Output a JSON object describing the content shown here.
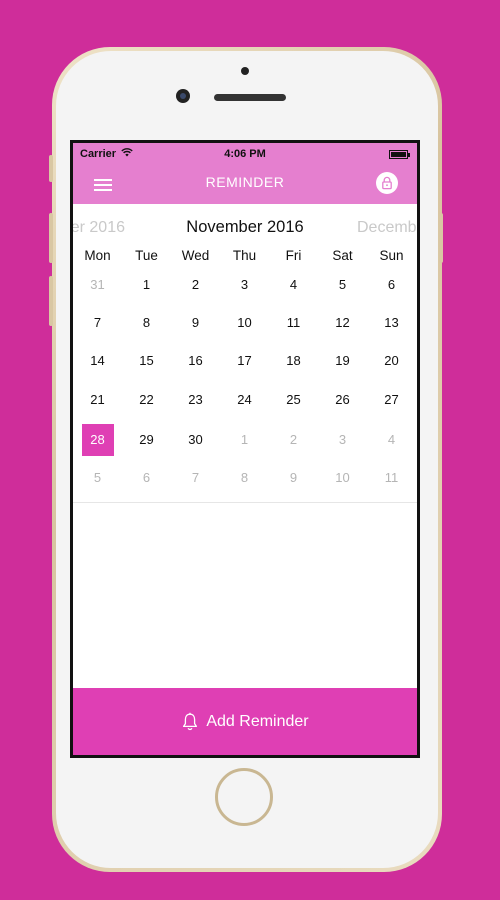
{
  "status_bar": {
    "carrier": "Carrier",
    "time": "4:06 PM"
  },
  "header": {
    "title": "REMINDER"
  },
  "calendar": {
    "prev_month": "er 2016",
    "current_month": "November 2016",
    "next_month": "Decemb",
    "weekdays": [
      "Mon",
      "Tue",
      "Wed",
      "Thu",
      "Fri",
      "Sat",
      "Sun"
    ],
    "weeks": [
      [
        "31",
        "1",
        "2",
        "3",
        "4",
        "5",
        "6"
      ],
      [
        "7",
        "8",
        "9",
        "10",
        "11",
        "12",
        "13"
      ],
      [
        "14",
        "15",
        "16",
        "17",
        "18",
        "19",
        "20"
      ],
      [
        "21",
        "22",
        "23",
        "24",
        "25",
        "26",
        "27"
      ],
      [
        "28",
        "29",
        "30",
        "1",
        "2",
        "3",
        "4"
      ],
      [
        "5",
        "6",
        "7",
        "8",
        "9",
        "10",
        "11"
      ]
    ],
    "selected_day": "28"
  },
  "add_button": {
    "label": "Add Reminder"
  },
  "colors": {
    "background": "#cf2d9a",
    "header": "#e57fcf",
    "accent": "#df3fb4"
  }
}
